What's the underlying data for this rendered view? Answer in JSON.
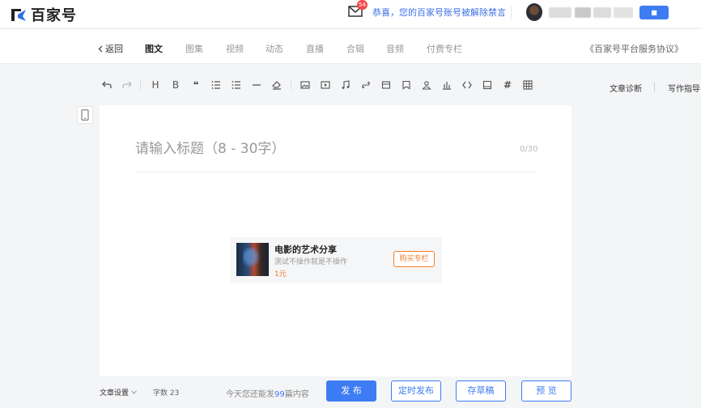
{
  "header": {
    "logo_text": "百家号",
    "mail_badge": "54",
    "notice": "恭喜，您的百家号账号被解除禁言",
    "user_button": "■"
  },
  "nav": {
    "back_label": "返回",
    "tabs": [
      "图文",
      "图集",
      "视频",
      "动态",
      "直播",
      "合辑",
      "音频",
      "付费专栏"
    ],
    "agreement": "《百家号平台服务协议》"
  },
  "toolbar": {
    "heading": "H",
    "bold": "B",
    "quote": "❝",
    "hash": "#",
    "diagnose": "文章诊断",
    "writing_guide": "写作指导"
  },
  "editor": {
    "title_placeholder": "请输入标题（8 - 30字）",
    "title_count": "0/30",
    "card": {
      "title": "电影的艺术分享",
      "desc": "测试不操作就是不操作",
      "price": "1元",
      "buy_label": "购买专栏"
    }
  },
  "footer": {
    "settings_label": "文章设置",
    "word_count": "字数 23",
    "remain_prefix": "今天您还能发",
    "remain_num": "99",
    "remain_suffix": "篇内容",
    "publish": "发 布",
    "schedule": "定时发布",
    "draft": "存草稿",
    "preview": "预 览"
  },
  "colors": {
    "brand_blue": "#3d7cf2",
    "accent_orange": "#f17e2a",
    "badge_red": "#f5484a"
  }
}
